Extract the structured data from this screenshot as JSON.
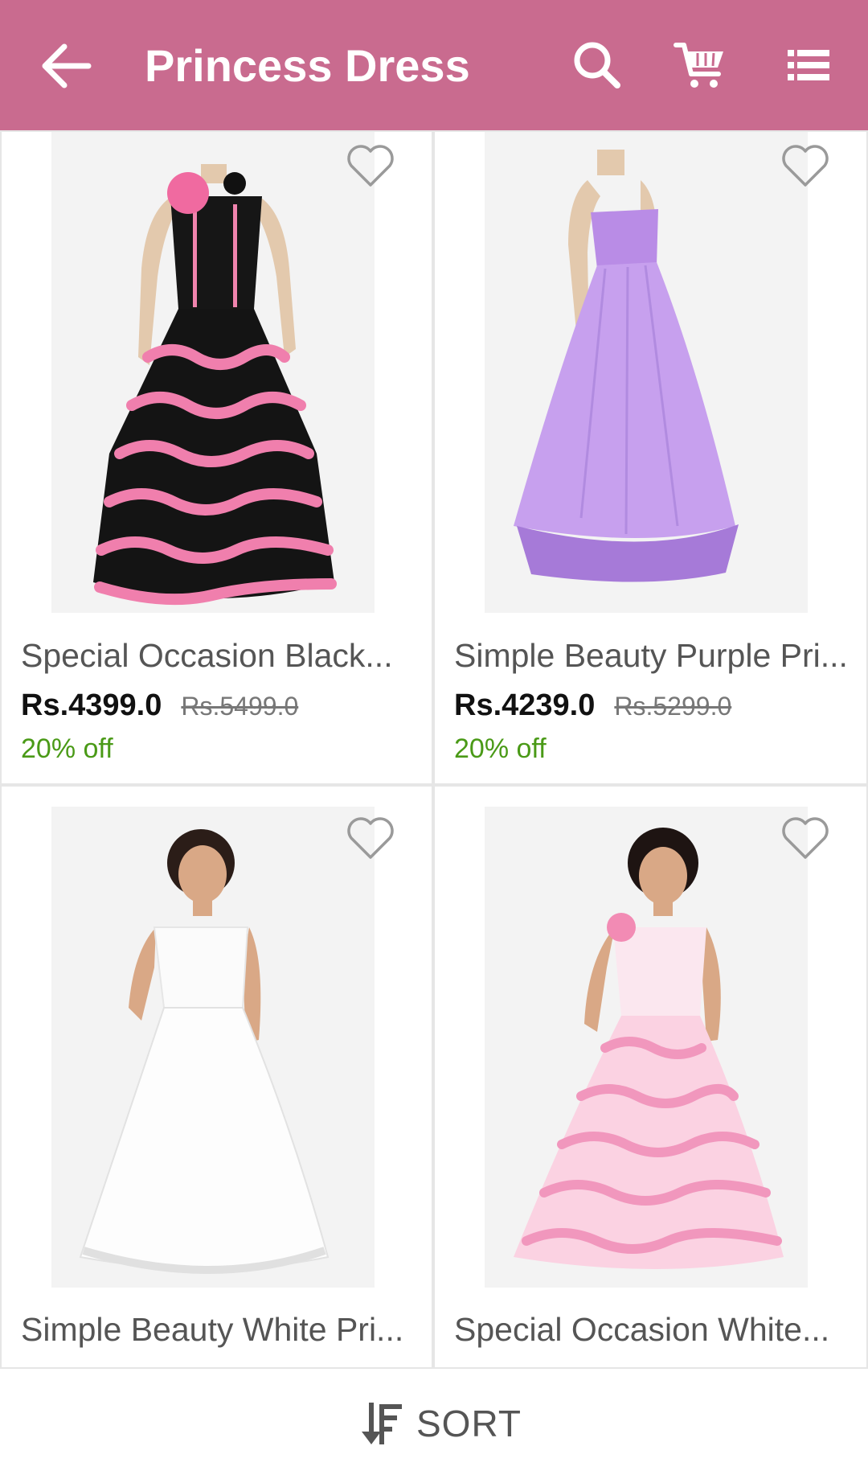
{
  "header": {
    "title": "Princess Dress",
    "back_icon": "arrow-left-icon",
    "search_icon": "search-icon",
    "cart_icon": "cart-icon",
    "menu_icon": "list-icon",
    "background": "#c96b8f"
  },
  "products": [
    {
      "name": "Special Occasion Black...",
      "price": "Rs.4399.0",
      "mrp": "Rs.5499.0",
      "discount": "20% off"
    },
    {
      "name": "Simple Beauty Purple Pri...",
      "price": "Rs.4239.0",
      "mrp": "Rs.5299.0",
      "discount": "20% off"
    },
    {
      "name": "Simple Beauty White Pri..."
    },
    {
      "name": "Special Occasion White..."
    }
  ],
  "bottom_bar": {
    "sort_label": "SORT",
    "sort_icon": "sort-icon"
  },
  "colors": {
    "discount": "#4a9a17",
    "wishlist_outline": "#9a9a9a"
  }
}
